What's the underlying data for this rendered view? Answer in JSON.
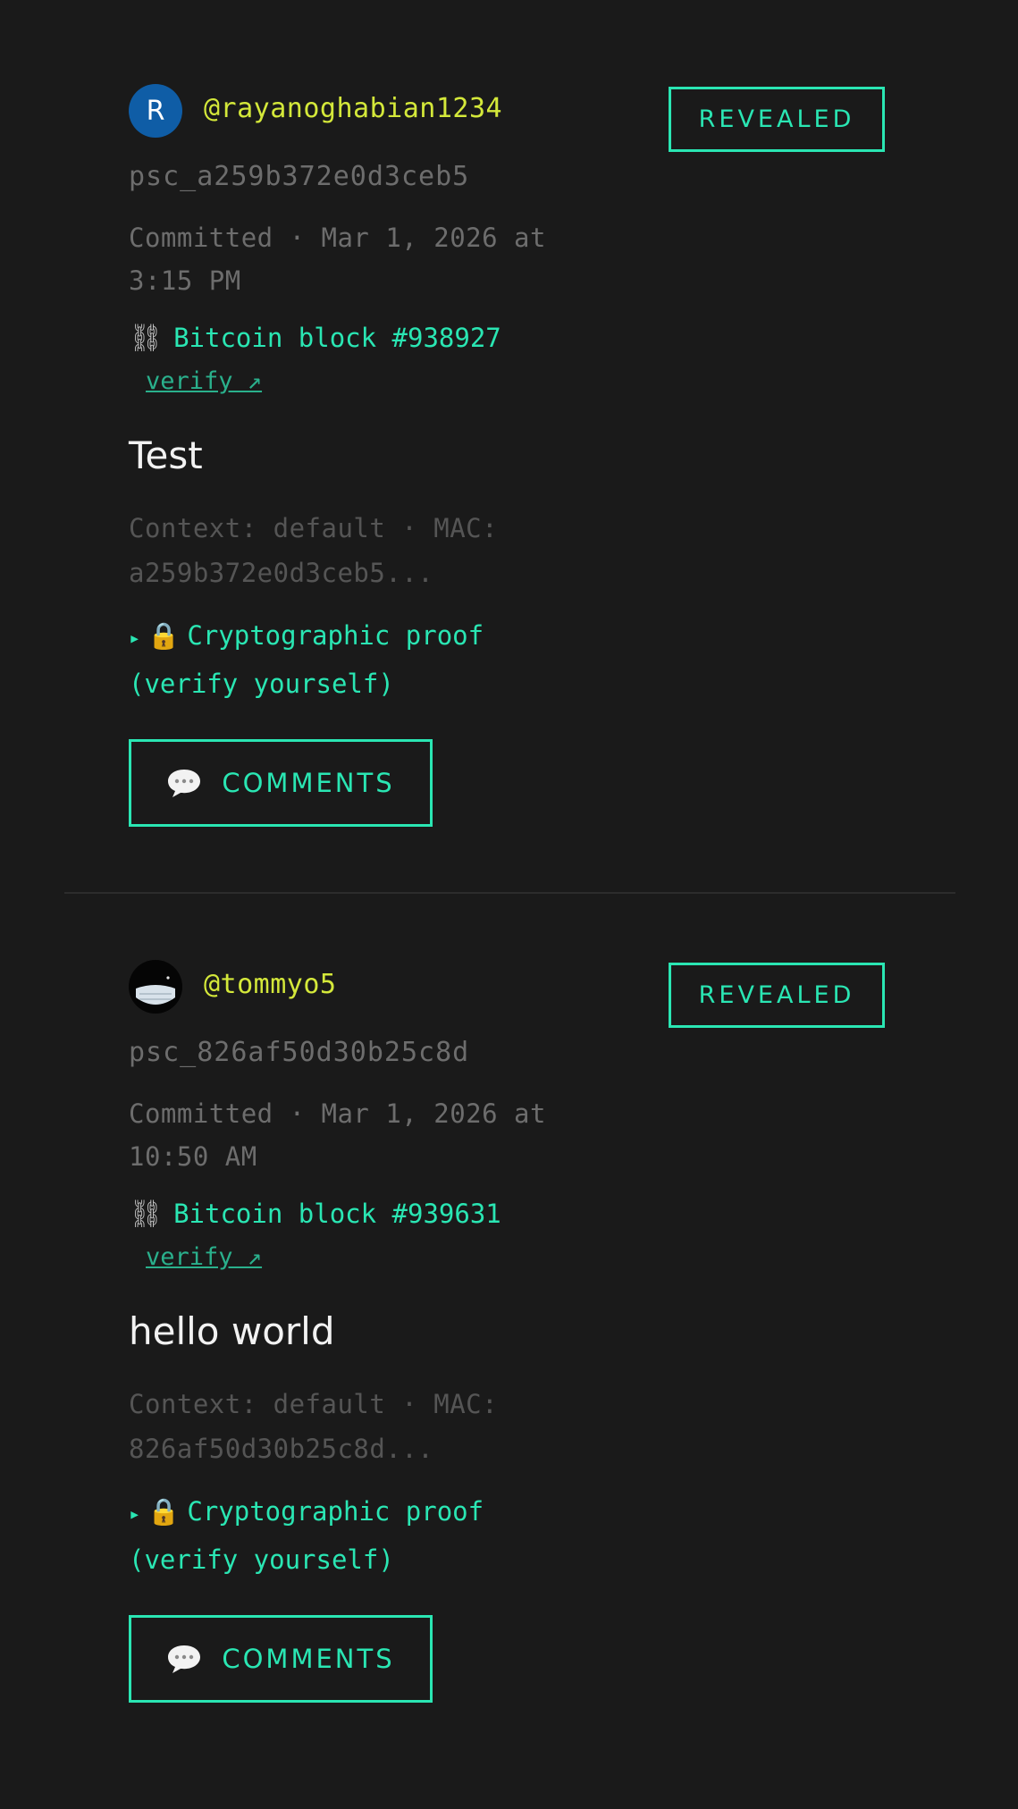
{
  "posts": [
    {
      "avatar_letter": "R",
      "handle": "@rayanoghabian1234",
      "status": "REVEALED",
      "commit_id": "psc_a259b372e0d3ceb5",
      "committed": "Committed · Mar 1, 2026 at 3:15 PM",
      "block_icon": "⛓",
      "block": "Bitcoin block #938927",
      "verify": "verify ↗",
      "content": "Test",
      "context": "Context: default · MAC: a259b372e0d3ceb5...",
      "proof_arrow": "▸",
      "proof_icon": "🔒",
      "proof": "Cryptographic proof (verify yourself)",
      "comments": "COMMENTS"
    },
    {
      "handle": "@tommyo5",
      "status": "REVEALED",
      "commit_id": "psc_826af50d30b25c8d",
      "committed": "Committed · Mar 1, 2026 at 10:50 AM",
      "block_icon": "⛓",
      "block": "Bitcoin block #939631",
      "verify": "verify ↗",
      "content": "hello world",
      "context": "Context: default · MAC: 826af50d30b25c8d...",
      "proof_arrow": "▸",
      "proof_icon": "🔒",
      "proof": "Cryptographic proof (verify yourself)",
      "comments": "COMMENTS"
    }
  ],
  "colors": {
    "background": "#1a1a1a",
    "accent": "#2ae6b3",
    "handle": "#d4e83a",
    "muted": "#6d6d6d",
    "avatar_blue": "#0f5da6"
  },
  "icons": {
    "chain": "chain-icon",
    "lock": "lock-icon",
    "comments": "speech-bubble-icon",
    "expand": "triangle-right-icon"
  }
}
